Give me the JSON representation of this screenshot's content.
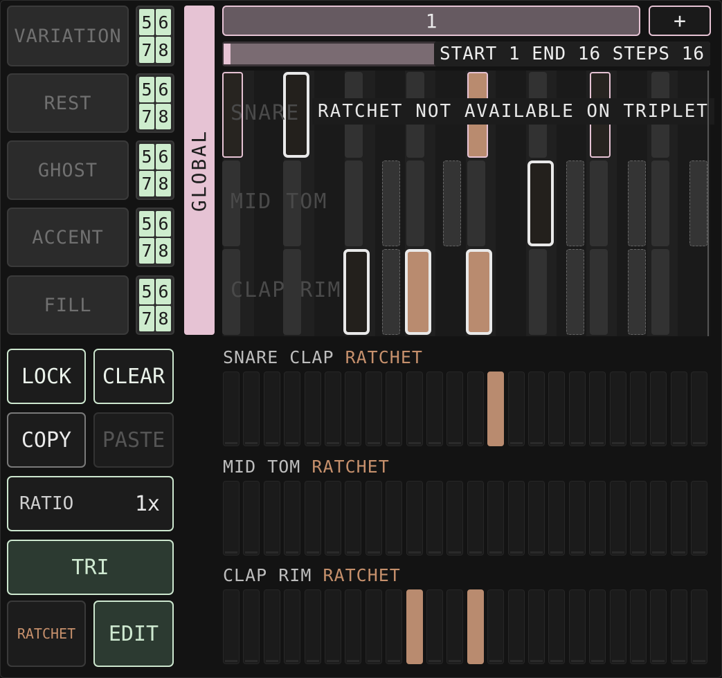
{
  "modes": [
    {
      "label": "VARIATION",
      "nums": [
        "5",
        "6",
        "7",
        "8"
      ]
    },
    {
      "label": "REST",
      "nums": [
        "5",
        "6",
        "7",
        "8"
      ]
    },
    {
      "label": "GHOST",
      "nums": [
        "5",
        "6",
        "7",
        "8"
      ]
    },
    {
      "label": "ACCENT",
      "nums": [
        "5",
        "6",
        "7",
        "8"
      ]
    },
    {
      "label": "FILL",
      "nums": [
        "5",
        "6",
        "7",
        "8"
      ]
    }
  ],
  "global_label": "GLOBAL",
  "actions": {
    "lock": "LOCK",
    "clear": "CLEAR",
    "copy": "COPY",
    "paste": "PASTE",
    "ratio_label": "RATIO",
    "ratio_value": "1x",
    "tri": "TRI",
    "ratchet": "RATCHET",
    "edit": "EDIT"
  },
  "pattern": {
    "value": "1",
    "plus": "+"
  },
  "range": {
    "label": "START 1 END 16 STEPS 16",
    "start": 1,
    "end": 16,
    "steps": 16
  },
  "lanes": [
    {
      "label": "SNARE"
    },
    {
      "label": "MID TOM"
    },
    {
      "label": "CLAP RIM"
    }
  ],
  "message": "RATCHET NOT AVAILABLE ON TRIPLET",
  "ratchet_sections": [
    {
      "name": "SNARE CLAP",
      "suffix": "RATCHET",
      "active_steps": [
        13
      ]
    },
    {
      "name": "MID TOM",
      "suffix": "RATCHET",
      "active_steps": []
    },
    {
      "name": "CLAP RIM",
      "suffix": "RATCHET",
      "active_steps": [
        9,
        12
      ]
    }
  ],
  "colors": {
    "accent_pink": "#e6c3d4",
    "accent_green": "#cde7cf",
    "step_on": "#b98b6f",
    "ratchet_text": "#c6906c"
  }
}
